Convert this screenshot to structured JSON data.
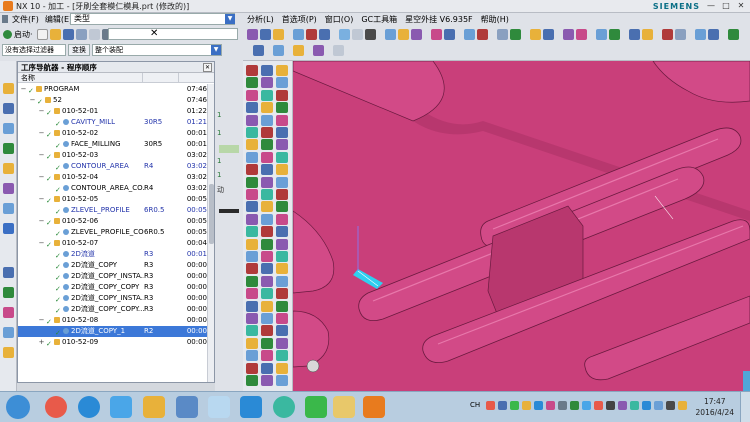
{
  "titlebar": {
    "title": "NX 10 - 加工 - [牙刷全套模仁模具.prt  (修改的)]",
    "brand": "SIEMENS",
    "min": "—",
    "max": "□",
    "close": "✕"
  },
  "menu_left": {
    "file": "文件(F)",
    "edit": "编辑(E)",
    "type_label": "类型"
  },
  "toolbar_left": {
    "start": "启动·",
    "filter": "没有选择过滤器",
    "whole_assembly": "整个装配"
  },
  "menu_right": [
    "分析(L)",
    "首选项(P)",
    "窗口(O)",
    "GC工具箱",
    "星空外挂 V6.935F",
    "帮助(H)"
  ],
  "navigator": {
    "title": "工序导航器 - 程序顺序",
    "close": "✕",
    "col_name": "名称",
    "rows": [
      {
        "indent": 0,
        "sign": "−",
        "icon": "folder",
        "name": "PROGRAM",
        "c2": "",
        "c3": "07:46",
        "style": ""
      },
      {
        "indent": 1,
        "sign": "−",
        "icon": "folder",
        "name": "52",
        "c2": "",
        "c3": "07:46",
        "style": ""
      },
      {
        "indent": 2,
        "sign": "−",
        "icon": "folder",
        "name": "010-52-01",
        "c2": "",
        "c3": "01:22",
        "style": ""
      },
      {
        "indent": 3,
        "sign": "",
        "icon": "op",
        "name": "CAVITY_MILL",
        "c2": "30R5",
        "c3": "01:21",
        "style": "blue"
      },
      {
        "indent": 2,
        "sign": "−",
        "icon": "folder",
        "name": "010-52-02",
        "c2": "",
        "c3": "00:01",
        "style": ""
      },
      {
        "indent": 3,
        "sign": "",
        "icon": "op",
        "name": "FACE_MILLING",
        "c2": "30R5",
        "c3": "00:01",
        "style": ""
      },
      {
        "indent": 2,
        "sign": "−",
        "icon": "folder",
        "name": "010-52-03",
        "c2": "",
        "c3": "03:02",
        "style": ""
      },
      {
        "indent": 3,
        "sign": "",
        "icon": "op",
        "name": "CONTOUR_AREA",
        "c2": "R4",
        "c3": "03:02",
        "style": "blue"
      },
      {
        "indent": 2,
        "sign": "−",
        "icon": "folder",
        "name": "010-52-04",
        "c2": "",
        "c3": "03:02",
        "style": ""
      },
      {
        "indent": 3,
        "sign": "",
        "icon": "op",
        "name": "CONTOUR_AREA_CO...",
        "c2": "R4",
        "c3": "03:02",
        "style": ""
      },
      {
        "indent": 2,
        "sign": "−",
        "icon": "folder",
        "name": "010-52-05",
        "c2": "",
        "c3": "00:05",
        "style": ""
      },
      {
        "indent": 3,
        "sign": "",
        "icon": "op",
        "name": "ZLEVEL_PROFILE",
        "c2": "6R0.5",
        "c3": "00:05",
        "style": "blue"
      },
      {
        "indent": 2,
        "sign": "−",
        "icon": "folder",
        "name": "010-52-06",
        "c2": "",
        "c3": "00:05",
        "style": ""
      },
      {
        "indent": 3,
        "sign": "",
        "icon": "op",
        "name": "ZLEVEL_PROFILE_CO...",
        "c2": "6R0.5",
        "c3": "00:05",
        "style": ""
      },
      {
        "indent": 2,
        "sign": "−",
        "icon": "folder",
        "name": "010-52-07",
        "c2": "",
        "c3": "00:04",
        "style": ""
      },
      {
        "indent": 3,
        "sign": "",
        "icon": "op",
        "name": "2D流道",
        "c2": "R3",
        "c3": "00:01",
        "style": "blue"
      },
      {
        "indent": 3,
        "sign": "",
        "icon": "op",
        "name": "2D流道_COPY",
        "c2": "R3",
        "c3": "00:00",
        "style": ""
      },
      {
        "indent": 3,
        "sign": "",
        "icon": "op",
        "name": "2D流道_COPY_INSTA...",
        "c2": "R3",
        "c3": "00:00",
        "style": ""
      },
      {
        "indent": 3,
        "sign": "",
        "icon": "op",
        "name": "2D流道_COPY_COPY",
        "c2": "R3",
        "c3": "00:00",
        "style": ""
      },
      {
        "indent": 3,
        "sign": "",
        "icon": "op",
        "name": "2D流道_COPY_INSTA...",
        "c2": "R3",
        "c3": "00:00",
        "style": ""
      },
      {
        "indent": 3,
        "sign": "",
        "icon": "op",
        "name": "2D流道_COPY_COPY...",
        "c2": "R3",
        "c3": "00:00",
        "style": ""
      },
      {
        "indent": 2,
        "sign": "−",
        "icon": "folder",
        "name": "010-52-08",
        "c2": "",
        "c3": "00:00",
        "style": ""
      },
      {
        "indent": 3,
        "sign": "",
        "icon": "op",
        "name": "2D流道_COPY_1",
        "c2": "R2",
        "c3": "00:00",
        "style": "sel"
      },
      {
        "indent": 2,
        "sign": "+",
        "icon": "folder",
        "name": "010-52-09",
        "c2": "",
        "c3": "00:00",
        "style": ""
      }
    ]
  },
  "mid_panel": {
    "m1": "1",
    "m2": "1",
    "m3": "1",
    "m4": "1",
    "m5": "1",
    "label": "动"
  },
  "tray": {
    "time": "17:47",
    "date": "2016/4/24",
    "lang": "CH"
  },
  "colors": {
    "viewport": "#c93f7a",
    "selection": "#3c78d8",
    "op_blue": "#2233aa"
  }
}
